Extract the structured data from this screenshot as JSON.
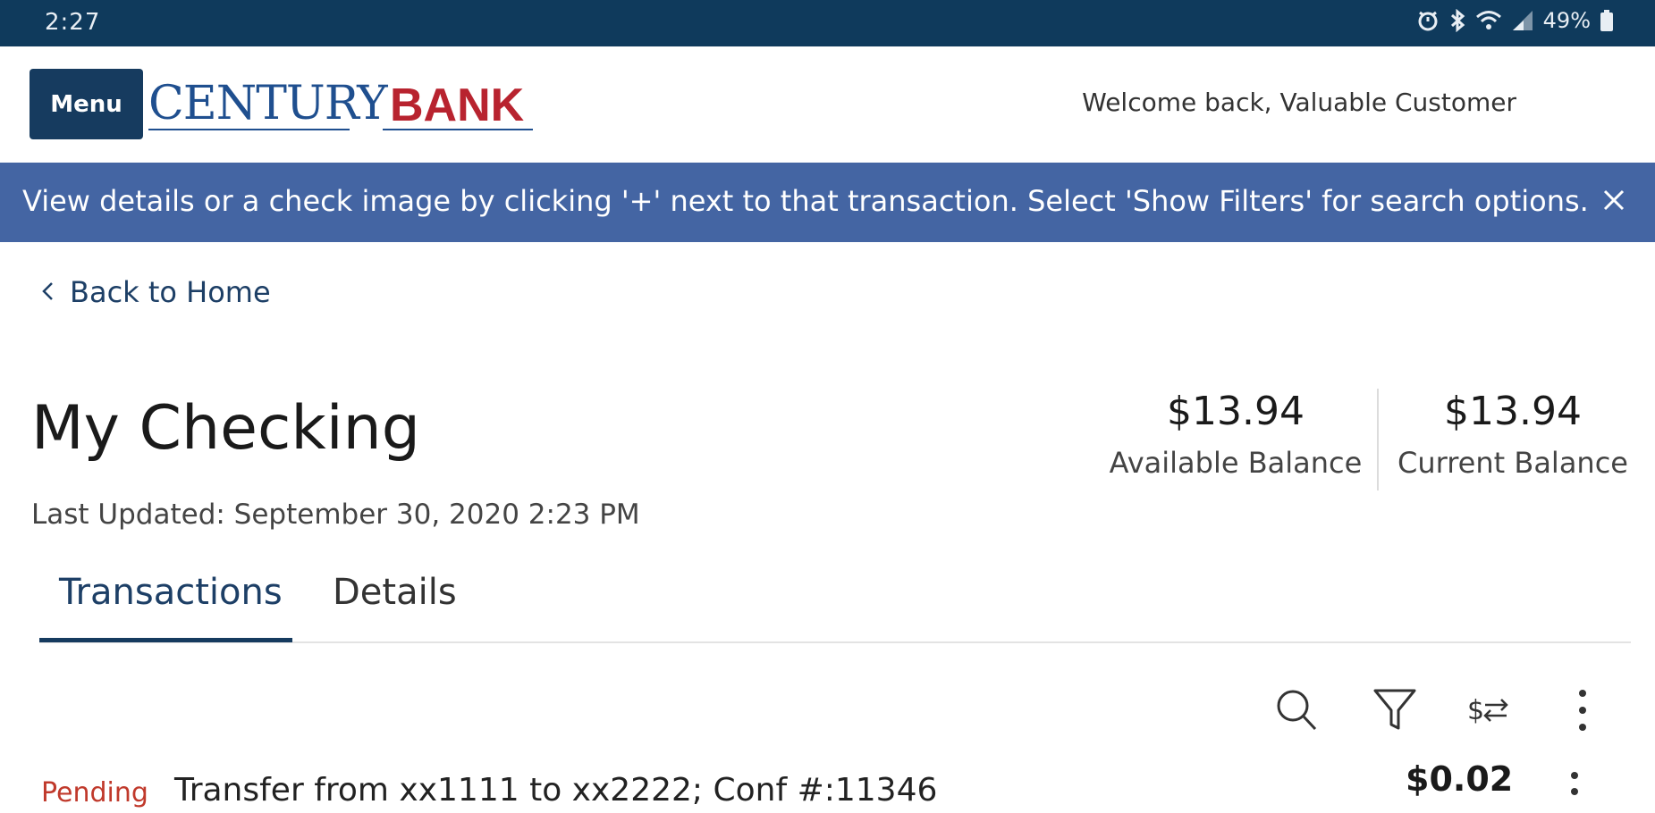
{
  "status_bar": {
    "time": "2:27",
    "battery": "49%",
    "icons": [
      "alarm-icon",
      "bluetooth-icon",
      "wifi-icon",
      "signal-icon",
      "battery-icon"
    ]
  },
  "header": {
    "menu_label": "Menu",
    "logo": {
      "century": "CENTURY",
      "bank": "BANK"
    },
    "welcome": "Welcome back, Valuable Customer"
  },
  "banner": {
    "message": "View details or a check image by clicking '+' next to that transaction. Select 'Show Filters' for search options.",
    "close_icon": "close-icon"
  },
  "nav": {
    "back_label": "Back to Home"
  },
  "account": {
    "title": "My Checking",
    "last_updated": "Last Updated: September 30, 2020 2:23 PM",
    "available_balance": "$13.94",
    "available_label": "Available Balance",
    "current_balance": "$13.94",
    "current_label": "Current Balance"
  },
  "tabs": [
    {
      "label": "Transactions",
      "active": true
    },
    {
      "label": "Details",
      "active": false
    }
  ],
  "toolbar": {
    "icons": [
      "search-icon",
      "filter-icon",
      "transfer-icon",
      "more-vertical-icon"
    ]
  },
  "transactions": [
    {
      "status": "Pending",
      "description": "Transfer from xx1111 to xx2222; Conf #:11346",
      "amount": "$0.02"
    }
  ],
  "colors": {
    "status_bar": "#0f3a5c",
    "primary": "#163b5f",
    "banner": "#4465a3",
    "logo_blue": "#1f4f8f",
    "logo_red": "#b8232f",
    "pending": "#c0392b"
  }
}
